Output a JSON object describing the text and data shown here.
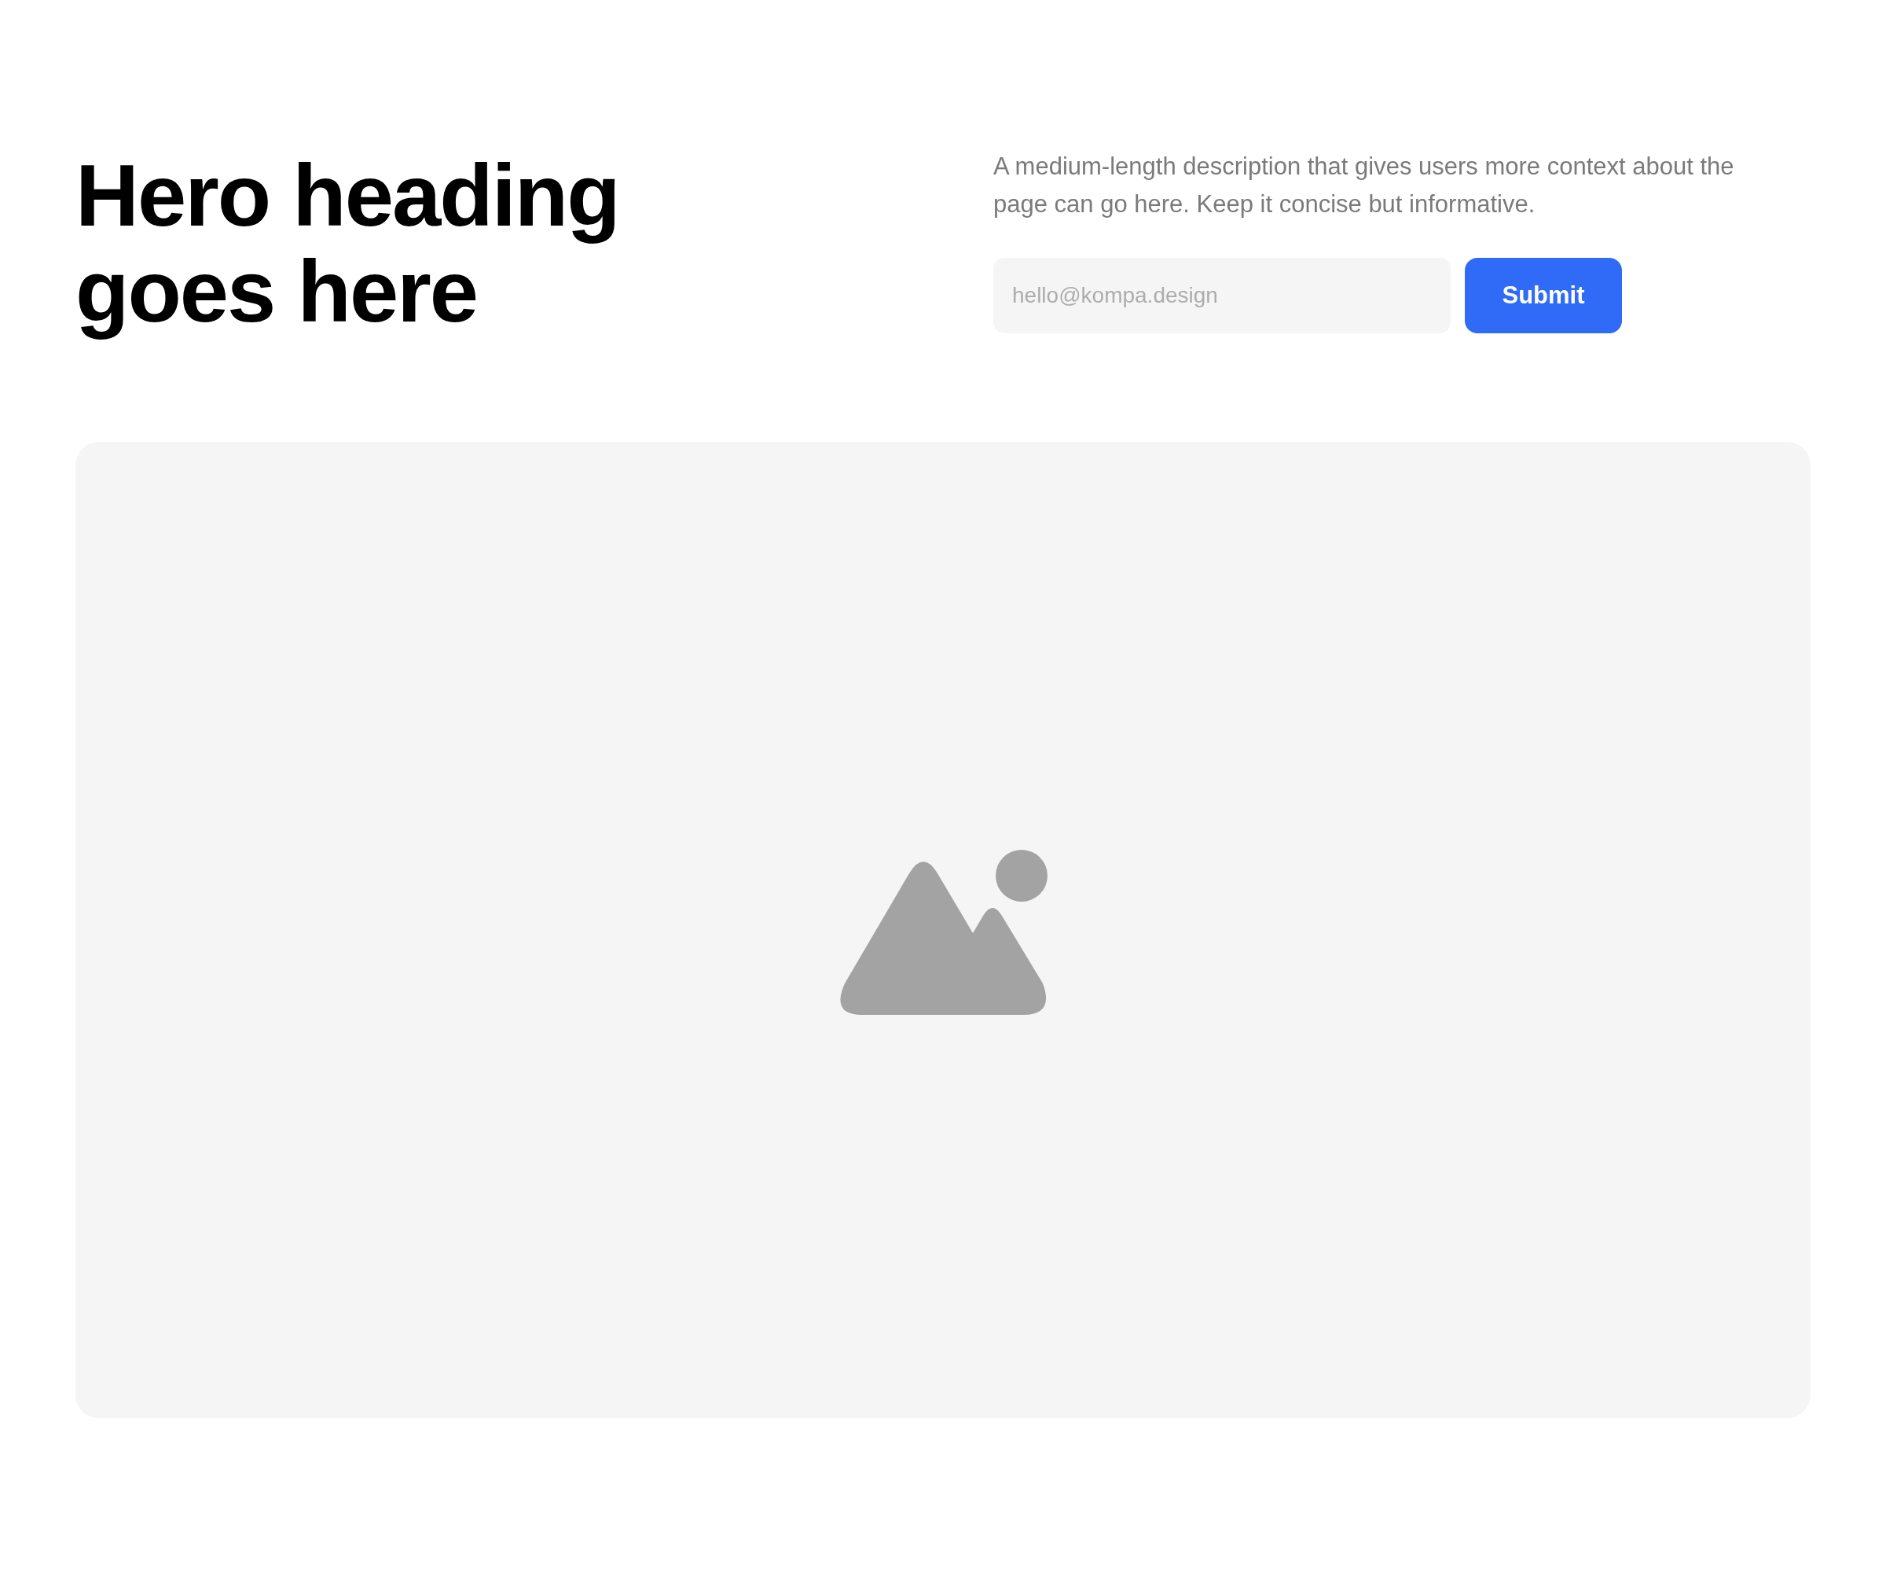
{
  "hero": {
    "heading": "Hero heading goes here",
    "description": "A medium-length description that gives users more context about the page can go here. Keep it concise but informative.",
    "email_field": {
      "placeholder": "hello@kompa.design"
    },
    "submit_button": {
      "label": "Submit"
    }
  },
  "media": {
    "kind": "image-placeholder"
  }
}
